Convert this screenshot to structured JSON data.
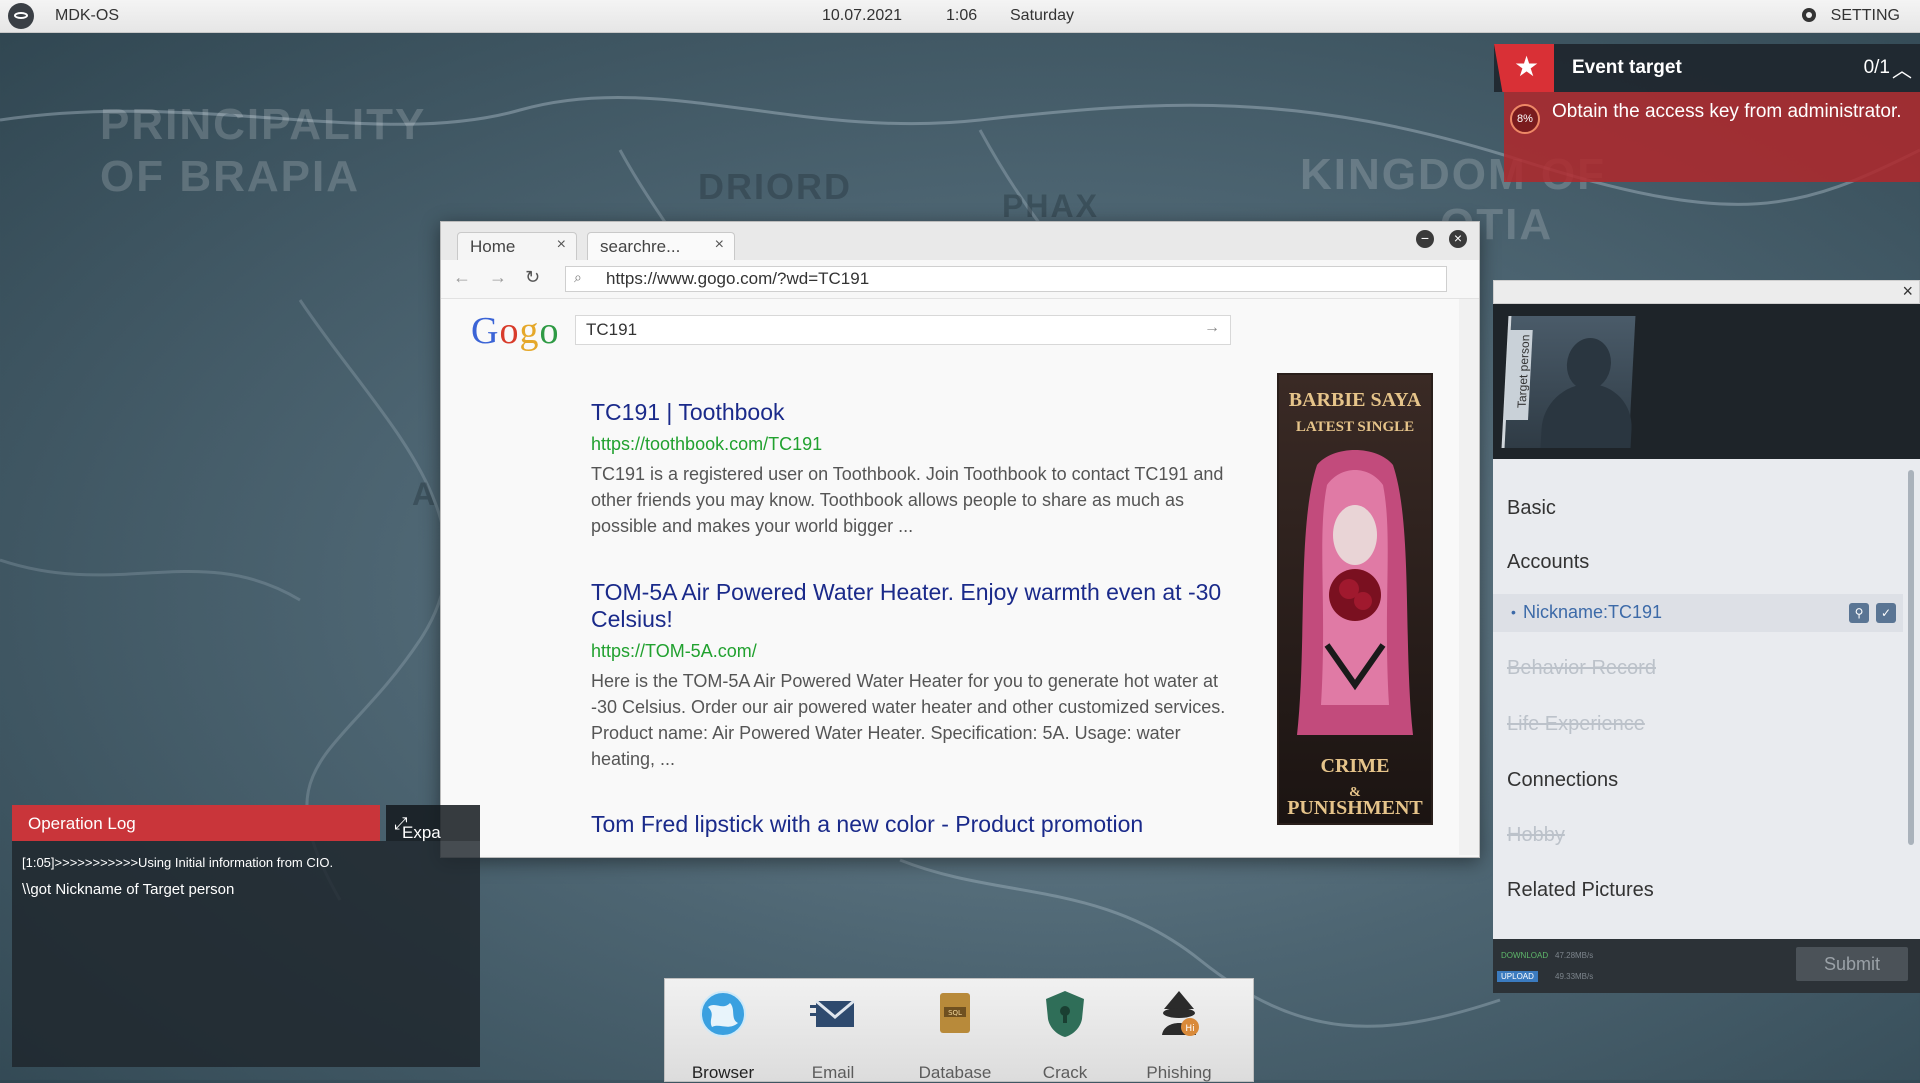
{
  "topbar": {
    "os_name": "MDK-OS",
    "date": "10.07.2021",
    "time": "1:06",
    "day": "Saturday",
    "setting_label": "SETTING"
  },
  "map": {
    "labels": [
      "PRINCIPALITY",
      "OF BRAPIA",
      "DRIORD",
      "PHAX",
      "KINGDOM OF",
      "OTIA",
      "A"
    ]
  },
  "event_target": {
    "title": "Event target",
    "count": "0/1",
    "progress": "8%",
    "description": "Obtain the access key from administrator."
  },
  "browser": {
    "tabs": [
      {
        "label": "Home",
        "close": "×"
      },
      {
        "label": "searchre...",
        "close": "×"
      }
    ],
    "url": "https://www.gogo.com/?wd=TC191",
    "logo": "Gogo",
    "query": "TC191",
    "results": [
      {
        "title": "TC191 | Toothbook",
        "url": "https://toothbook.com/TC191",
        "snippet": "TC191 is a registered user on Toothbook. Join Toothbook to contact TC191 and other friends you may know. Toothbook allows people to share as much as possible and makes your world bigger  ..."
      },
      {
        "title": "TOM-5A Air Powered Water Heater. Enjoy warmth even at -30 Celsius!",
        "url": "https://TOM-5A.com/",
        "snippet": "Here is the TOM-5A Air Powered Water Heater for you to generate hot water at -30 Celsius. Order our air powered water heater and other customized services. Product name: Air Powered Water Heater. Specification: 5A. Usage: water heating, ..."
      },
      {
        "title": "Tom Fred lipstick with a new color - Product promotion"
      }
    ],
    "ad": {
      "line1": "BARBIE SAYA",
      "line2": "LATEST SINGLE",
      "line3": "CRIME",
      "line4": "&",
      "line5": "PUNISHMENT"
    }
  },
  "target_panel": {
    "tag": "Target person",
    "sections": {
      "basic": "Basic",
      "accounts": "Accounts",
      "account_item": "Nickname:TC191",
      "behavior": "Behavior Record",
      "life": "Life Experience",
      "connections": "Connections",
      "hobby": "Hobby",
      "pictures": "Related Pictures"
    },
    "download_label": "DOWNLOAD",
    "upload_label": "UPLOAD",
    "download_rate": "47.28MB/s",
    "upload_rate": "49.33MB/s",
    "submit_label": "Submit"
  },
  "operation_log": {
    "title": "Operation Log",
    "expand_label": "Expa",
    "lines": [
      "[1:05]>>>>>>>>>>>Using Initial information from CIO.",
      "\\\\got Nickname of Target person"
    ]
  },
  "dock": {
    "items": [
      {
        "label": "Browser",
        "icon": "globe-icon"
      },
      {
        "label": "Email",
        "icon": "envelope-icon"
      },
      {
        "label": "Database",
        "icon": "database-icon"
      },
      {
        "label": "Crack",
        "icon": "shield-icon"
      },
      {
        "label": "Phishing",
        "icon": "hacker-icon"
      }
    ]
  }
}
